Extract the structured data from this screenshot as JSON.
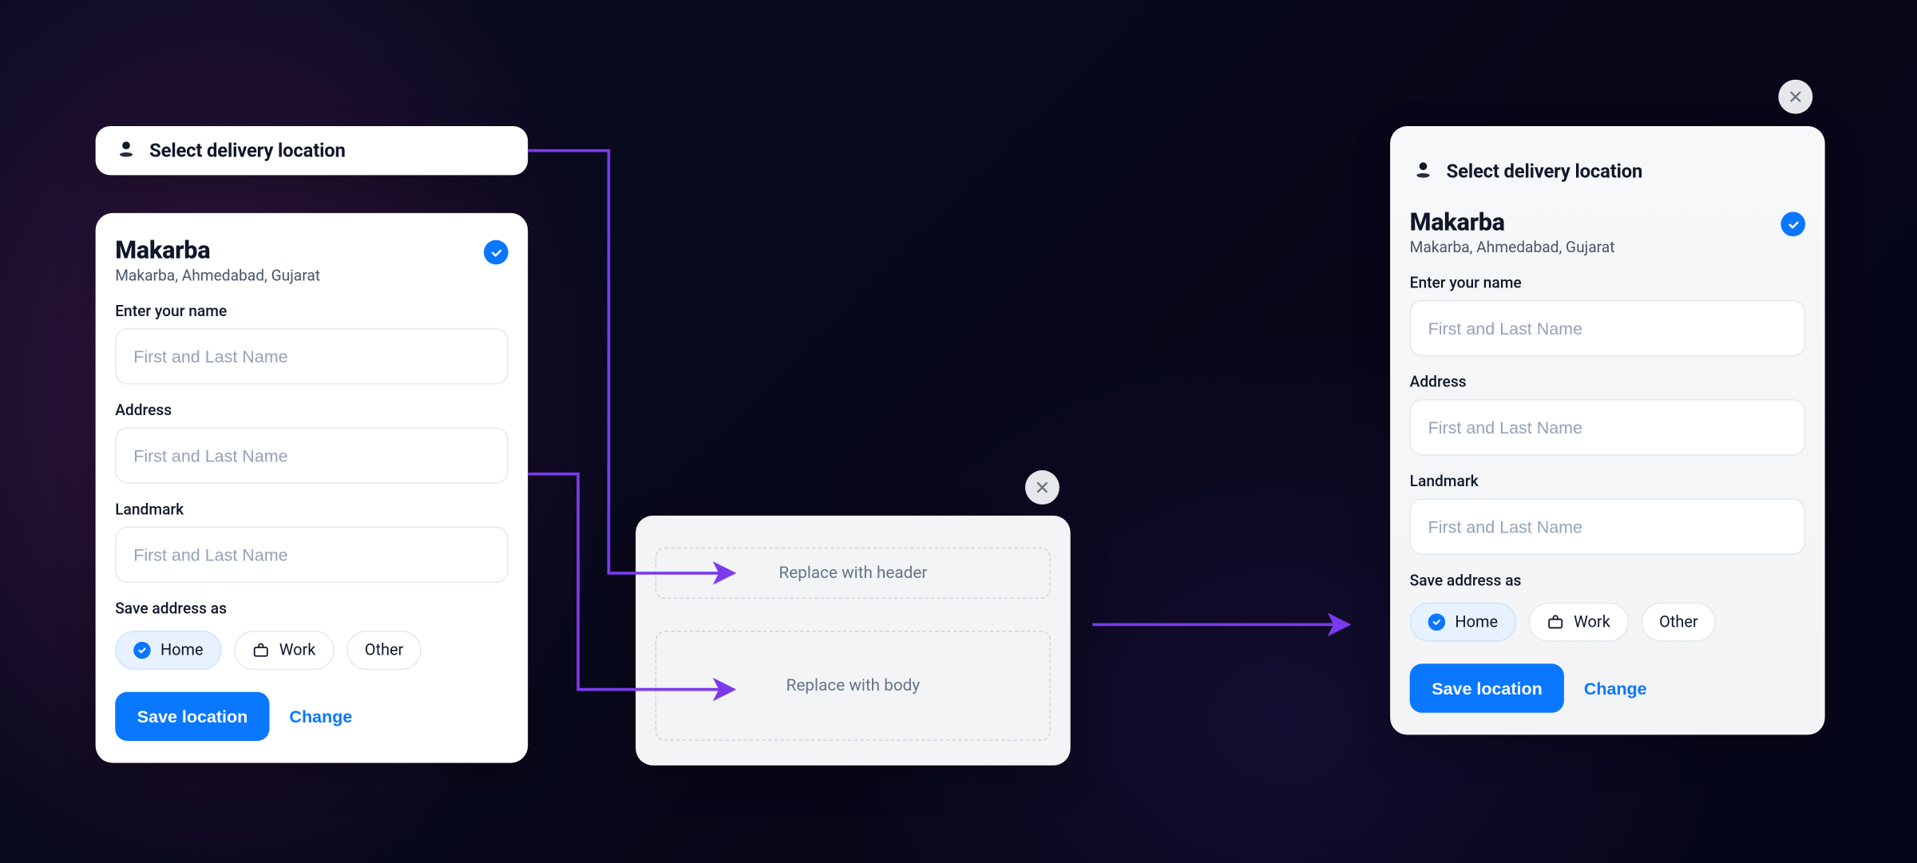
{
  "header": {
    "title": "Select delivery location"
  },
  "form": {
    "location_name": "Makarba",
    "location_subtitle": "Makarba, Ahmedabad, Gujarat",
    "name_label": "Enter your name",
    "name_placeholder": "First and Last Name",
    "address_label": "Address",
    "address_placeholder": "First and Last Name",
    "landmark_label": "Landmark",
    "landmark_placeholder": "First and Last Name",
    "save_as_label": "Save address as",
    "chips": {
      "home": "Home",
      "work": "Work",
      "other": "Other"
    },
    "save_button": "Save location",
    "change_link": "Change"
  },
  "skeleton": {
    "header_slot": "Replace with header",
    "body_slot": "Replace with body"
  },
  "colors": {
    "primary": "#0a77ff",
    "arrow": "#7c3aed"
  }
}
